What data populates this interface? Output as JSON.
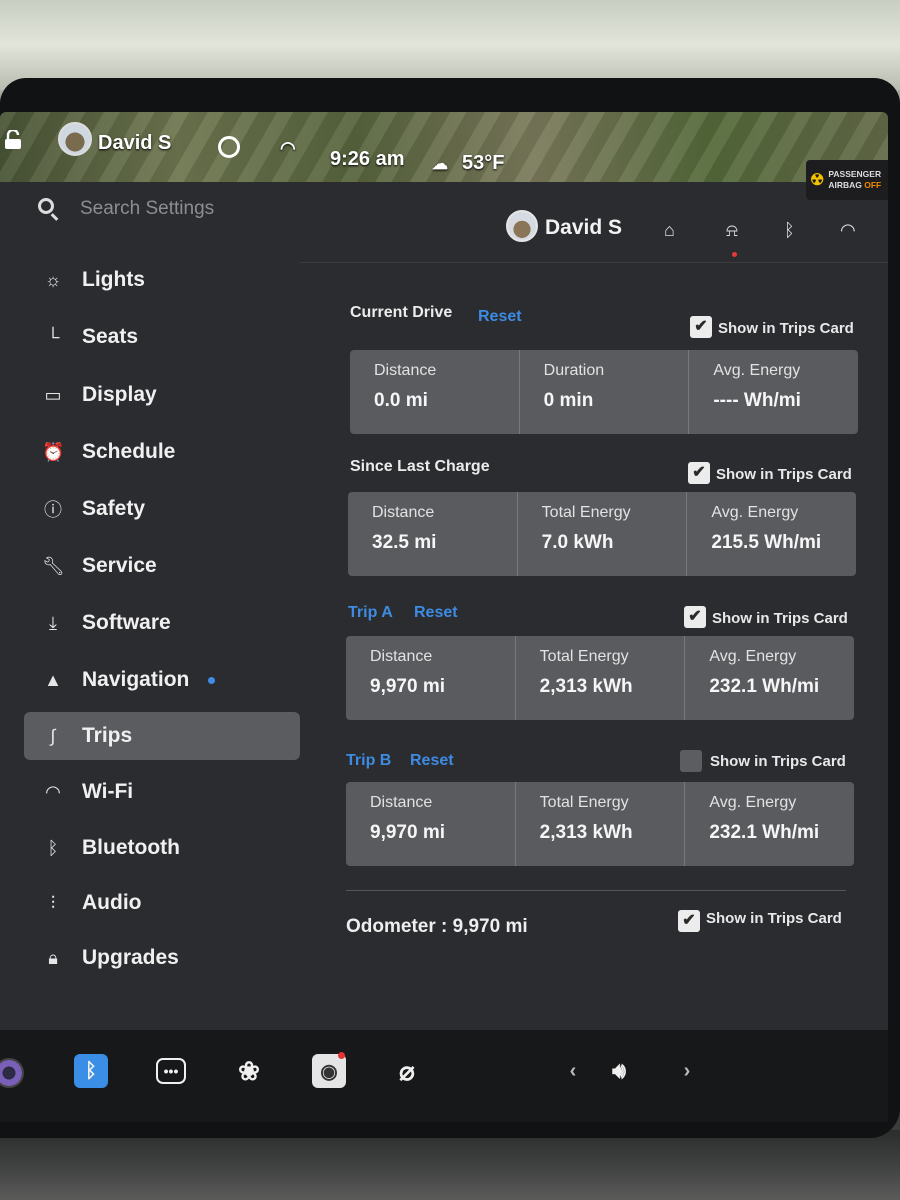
{
  "status_bar": {
    "driver_name": "David S",
    "time": "9:26 am",
    "temperature": "53°F",
    "airbag_line1": "PASSENGER",
    "airbag_line2": "AIRBAG",
    "airbag_status": "OFF"
  },
  "search": {
    "placeholder": "Search Settings"
  },
  "header": {
    "profile_name": "David S"
  },
  "sidebar": {
    "items": [
      {
        "label": "Lights",
        "icon": "sun-icon"
      },
      {
        "label": "Seats",
        "icon": "seat-icon"
      },
      {
        "label": "Display",
        "icon": "display-icon"
      },
      {
        "label": "Schedule",
        "icon": "clock-icon"
      },
      {
        "label": "Safety",
        "icon": "alert-circle-icon"
      },
      {
        "label": "Service",
        "icon": "wrench-icon"
      },
      {
        "label": "Software",
        "icon": "download-icon"
      },
      {
        "label": "Navigation",
        "icon": "navigation-arrow-icon"
      },
      {
        "label": "Trips",
        "icon": "trips-icon",
        "active": true
      },
      {
        "label": "Wi-Fi",
        "icon": "wifi-icon"
      },
      {
        "label": "Bluetooth",
        "icon": "bluetooth-icon"
      },
      {
        "label": "Audio",
        "icon": "equalizer-icon"
      },
      {
        "label": "Upgrades",
        "icon": "bag-icon"
      }
    ]
  },
  "content": {
    "show_label": "Show in Trips Card",
    "reset_label": "Reset",
    "current_drive": {
      "title": "Current Drive",
      "checked": true,
      "cells": [
        {
          "label": "Distance",
          "value": "0.0 mi"
        },
        {
          "label": "Duration",
          "value": "0 min"
        },
        {
          "label": "Avg. Energy",
          "value": "---- Wh/mi"
        }
      ]
    },
    "since_last_charge": {
      "title": "Since Last Charge",
      "checked": true,
      "cells": [
        {
          "label": "Distance",
          "value": "32.5 mi"
        },
        {
          "label": "Total Energy",
          "value": "7.0 kWh"
        },
        {
          "label": "Avg. Energy",
          "value": "215.5 Wh/mi"
        }
      ]
    },
    "trip_a": {
      "title": "Trip A",
      "checked": true,
      "cells": [
        {
          "label": "Distance",
          "value": "9,970 mi"
        },
        {
          "label": "Total Energy",
          "value": "2,313 kWh"
        },
        {
          "label": "Avg. Energy",
          "value": "232.1 Wh/mi"
        }
      ]
    },
    "trip_b": {
      "title": "Trip B",
      "checked": false,
      "cells": [
        {
          "label": "Distance",
          "value": "9,970 mi"
        },
        {
          "label": "Total Energy",
          "value": "2,313 kWh"
        },
        {
          "label": "Avg. Energy",
          "value": "232.1 Wh/mi"
        }
      ]
    },
    "odometer": {
      "text": "Odometer : 9,970 mi",
      "checked": true
    }
  },
  "colors": {
    "accent": "#3d8be2",
    "background": "#2b2c2f",
    "card": "#5a5b5f",
    "active_item": "#5b5c60"
  }
}
